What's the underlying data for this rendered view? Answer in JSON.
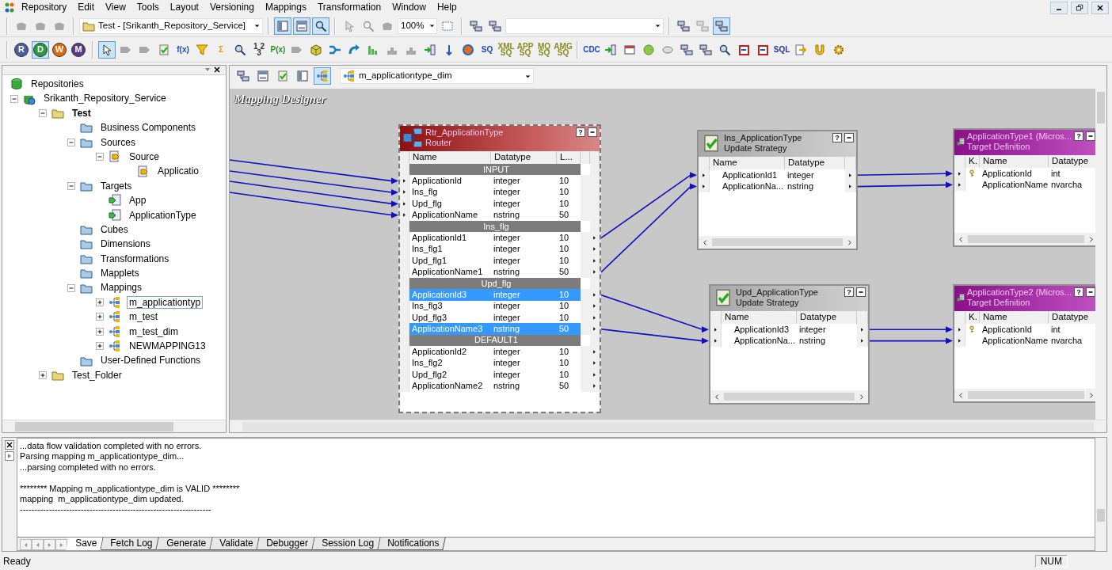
{
  "menu": [
    "Repository",
    "Edit",
    "View",
    "Tools",
    "Layout",
    "Versioning",
    "Mappings",
    "Transformation",
    "Window",
    "Help"
  ],
  "toolbar_1": [
    {
      "kind": "icon",
      "pressed": false
    },
    {
      "kind": "icon",
      "pressed": false
    },
    {
      "kind": "icon",
      "pressed": false
    },
    {
      "kind": "separator"
    },
    {
      "kind": "folder_combo",
      "text": "Test - [Srikanth_Repository_Service]"
    },
    {
      "kind": "separator"
    },
    {
      "kind": "icon",
      "pressed": true
    },
    {
      "kind": "icon",
      "pressed": true
    },
    {
      "kind": "icon",
      "pressed": true
    },
    {
      "kind": "separator"
    },
    {
      "kind": "icon",
      "pressed": false
    },
    {
      "kind": "icon",
      "pressed": false
    },
    {
      "kind": "icon",
      "pressed": false
    },
    {
      "kind": "combo",
      "text": "100%"
    },
    {
      "kind": "icon",
      "pressed": false
    },
    {
      "kind": "separator"
    },
    {
      "kind": "icon",
      "pressed": false
    },
    {
      "kind": "icon",
      "pressed": false
    },
    {
      "kind": "combo"
    },
    {
      "kind": "separator"
    },
    {
      "kind": "icon",
      "pressed": false
    },
    {
      "kind": "icon",
      "pressed": false
    },
    {
      "kind": "icon",
      "pressed": true
    }
  ],
  "toolbar_2": [
    {
      "kind": "circle",
      "text": "R",
      "color": "#4a5ea0",
      "pressed": false
    },
    {
      "kind": "circle",
      "text": "D",
      "color": "#2a9a3a",
      "pressed": true
    },
    {
      "kind": "circle",
      "text": "W",
      "color": "#e06a10",
      "pressed": false
    },
    {
      "kind": "circle",
      "text": "M",
      "color": "#5a3a8a",
      "pressed": false
    },
    {
      "kind": "separator"
    },
    {
      "kind": "icon",
      "pressed": true
    },
    {
      "kind": "icon",
      "pressed": false
    },
    {
      "kind": "icon",
      "pressed": false
    },
    {
      "kind": "icon",
      "pressed": false
    },
    {
      "kind": "label",
      "text": "f(x)",
      "color": "#1a4ac0",
      "pressed": false
    },
    {
      "kind": "icon",
      "pressed": false
    },
    {
      "kind": "label",
      "text": "Σ",
      "color": "#e0a000",
      "pressed": false
    },
    {
      "kind": "icon",
      "pressed": false
    },
    {
      "kind": "label",
      "text": "1 2 3",
      "color": "#333333",
      "pressed": false
    },
    {
      "kind": "label",
      "text": "P(x)",
      "color": "#2a8a2a",
      "pressed": false
    },
    {
      "kind": "icon",
      "pressed": false
    },
    {
      "kind": "icon",
      "pressed": false
    },
    {
      "kind": "icon",
      "pressed": false
    },
    {
      "kind": "icon",
      "pressed": false
    },
    {
      "kind": "icon",
      "pressed": false
    },
    {
      "kind": "icon",
      "pressed": false
    },
    {
      "kind": "icon",
      "pressed": false
    },
    {
      "kind": "icon",
      "pressed": false
    },
    {
      "kind": "icon",
      "pressed": false
    },
    {
      "kind": "icon",
      "pressed": false
    },
    {
      "kind": "label",
      "text": "SQ",
      "color": "#1a4ac0",
      "pressed": false
    },
    {
      "kind": "label",
      "text": "XML SQ",
      "color": "#8a8a20",
      "pressed": false
    },
    {
      "kind": "label",
      "text": "APP SQ",
      "color": "#8a8a20",
      "pressed": false
    },
    {
      "kind": "label",
      "text": "MQ SQ",
      "color": "#8a8a20",
      "pressed": false
    },
    {
      "kind": "label",
      "text": "AMG SQ",
      "color": "#8a8a20",
      "pressed": false
    },
    {
      "kind": "separator"
    },
    {
      "kind": "label",
      "text": "CDC",
      "color": "#1a4ac0",
      "pressed": false
    },
    {
      "kind": "icon",
      "pressed": false
    },
    {
      "kind": "icon",
      "pressed": false
    },
    {
      "kind": "icon",
      "pressed": false
    },
    {
      "kind": "icon",
      "pressed": false
    },
    {
      "kind": "icon",
      "pressed": false
    },
    {
      "kind": "icon",
      "pressed": false
    },
    {
      "kind": "icon",
      "pressed": false
    },
    {
      "kind": "icon",
      "pressed": false
    },
    {
      "kind": "icon",
      "pressed": false
    },
    {
      "kind": "label",
      "text": "SQL",
      "color": "#1a3a9a",
      "pressed": false
    },
    {
      "kind": "icon",
      "pressed": false
    },
    {
      "kind": "icon",
      "pressed": false
    },
    {
      "kind": "icon",
      "pressed": false
    }
  ],
  "navigator": {
    "tree": [
      {
        "label": "Repositories",
        "kind": "repositories",
        "children": [
          {
            "label": "Srikanth_Repository_Service",
            "kind": "repository",
            "expanded": true,
            "children": [
              {
                "label": "Test",
                "kind": "folder",
                "expanded": true,
                "current": true,
                "children": [
                  {
                    "label": "Business Components",
                    "kind": "node_folder"
                  },
                  {
                    "label": "Sources",
                    "kind": "node_folder",
                    "expanded": true,
                    "children": [
                      {
                        "label": "Source",
                        "kind": "source",
                        "expanded": true,
                        "children": [
                          {
                            "label": "Applicatio",
                            "kind": "source"
                          }
                        ]
                      }
                    ]
                  },
                  {
                    "label": "Targets",
                    "kind": "node_folder",
                    "expanded": true,
                    "children": [
                      {
                        "label": "App",
                        "kind": "target"
                      },
                      {
                        "label": "ApplicationType",
                        "kind": "target"
                      }
                    ]
                  },
                  {
                    "label": "Cubes",
                    "kind": "node_folder"
                  },
                  {
                    "label": "Dimensions",
                    "kind": "node_folder"
                  },
                  {
                    "label": "Transformations",
                    "kind": "node_folder"
                  },
                  {
                    "label": "Mapplets",
                    "kind": "node_folder"
                  },
                  {
                    "label": "Mappings",
                    "kind": "node_folder",
                    "expanded": true,
                    "children": [
                      {
                        "label": "m_applicationtyp",
                        "kind": "mapping",
                        "expanded": false,
                        "selected": true
                      },
                      {
                        "label": "m_test",
                        "kind": "mapping",
                        "expanded": false,
                        "selected": false
                      },
                      {
                        "label": "m_test_dim",
                        "kind": "mapping",
                        "expanded": false,
                        "selected": false
                      },
                      {
                        "label": "NEWMAPPING13",
                        "kind": "mapping",
                        "expanded": false,
                        "selected": false
                      }
                    ]
                  },
                  {
                    "label": "User-Defined Functions",
                    "kind": "node_folder"
                  }
                ]
              },
              {
                "label": "Test_Folder",
                "kind": "folder",
                "expanded": false,
                "current": false
              }
            ]
          }
        ]
      }
    ]
  },
  "workspace": {
    "mapping_combo": "m_applicationtype_dim",
    "canvas_title": "Mapping Designer",
    "transformations": [
      {
        "kind": "router",
        "title": "Rtr_ApplicationType",
        "subtitle": "Router",
        "help": "?",
        "selected": true,
        "columns": [
          "Name",
          "Datatype",
          "L..."
        ],
        "groups": [
          {
            "name": "INPUT",
            "kind": "input",
            "ports": [
              {
                "name": "ApplicationId",
                "datatype": "integer",
                "length": "10",
                "selected": false
              },
              {
                "name": "Ins_flg",
                "datatype": "integer",
                "length": "10",
                "selected": false
              },
              {
                "name": "Upd_flg",
                "datatype": "integer",
                "length": "10",
                "selected": false
              },
              {
                "name": "ApplicationName",
                "datatype": "nstring",
                "length": "50",
                "selected": false
              }
            ]
          },
          {
            "name": "Ins_flg",
            "kind": "output",
            "ports": [
              {
                "name": "ApplicationId1",
                "datatype": "integer",
                "length": "10",
                "selected": false
              },
              {
                "name": "Ins_flg1",
                "datatype": "integer",
                "length": "10",
                "selected": false
              },
              {
                "name": "Upd_flg1",
                "datatype": "integer",
                "length": "10",
                "selected": false
              },
              {
                "name": "ApplicationName1",
                "datatype": "nstring",
                "length": "50",
                "selected": false
              }
            ]
          },
          {
            "name": "Upd_flg",
            "kind": "output",
            "ports": [
              {
                "name": "ApplicationId3",
                "datatype": "integer",
                "length": "10",
                "selected": true
              },
              {
                "name": "Ins_flg3",
                "datatype": "integer",
                "length": "10",
                "selected": false
              },
              {
                "name": "Upd_flg3",
                "datatype": "integer",
                "length": "10",
                "selected": false
              },
              {
                "name": "ApplicationName3",
                "datatype": "nstring",
                "length": "50",
                "selected": true
              }
            ]
          },
          {
            "name": "DEFAULT1",
            "kind": "output",
            "ports": [
              {
                "name": "ApplicationId2",
                "datatype": "integer",
                "length": "10",
                "selected": false
              },
              {
                "name": "Ins_flg2",
                "datatype": "integer",
                "length": "10",
                "selected": false
              },
              {
                "name": "Upd_flg2",
                "datatype": "integer",
                "length": "10",
                "selected": false
              },
              {
                "name": "ApplicationName2",
                "datatype": "nstring",
                "length": "50",
                "selected": false
              }
            ]
          }
        ]
      },
      {
        "kind": "update_strategy",
        "title": "Ins_ApplicationType",
        "subtitle": "Update Strategy",
        "help": "?",
        "selected": false,
        "columns": [
          "Name",
          "Datatype"
        ],
        "ports": [
          {
            "name": "ApplicationId1",
            "datatype": "integer"
          },
          {
            "name": "ApplicationNa...",
            "datatype": "nstring"
          }
        ]
      },
      {
        "kind": "target",
        "title": "ApplicationType1 (Micros...",
        "subtitle": "Target Definition",
        "help": "?",
        "selected": false,
        "columns": [
          "K.",
          "Name",
          "Datatype"
        ],
        "ports": [
          {
            "name": "ApplicationId",
            "datatype": "int",
            "key": true
          },
          {
            "name": "ApplicationName",
            "datatype": "nvarcha",
            "key": false
          }
        ]
      },
      {
        "kind": "update_strategy",
        "title": "Upd_ApplicationType",
        "subtitle": "Update Strategy",
        "help": "?",
        "selected": false,
        "columns": [
          "Name",
          "Datatype"
        ],
        "ports": [
          {
            "name": "ApplicationId3",
            "datatype": "integer"
          },
          {
            "name": "ApplicationNa...",
            "datatype": "nstring"
          }
        ]
      },
      {
        "kind": "target",
        "title": "ApplicationType2 (Micros...",
        "subtitle": "Target Definition",
        "help": "?",
        "selected": false,
        "columns": [
          "K.",
          "Name",
          "Datatype"
        ],
        "ports": [
          {
            "name": "ApplicationId",
            "datatype": "int",
            "key": true
          },
          {
            "name": "ApplicationName",
            "datatype": "nvarcha",
            "key": false
          }
        ]
      }
    ]
  },
  "output": {
    "blocks": [
      [
        "...data flow validation completed with no errors.",
        "Parsing mapping m_applicationtype_dim...",
        "...parsing completed with no errors."
      ],
      [
        "******** Mapping m_applicationtype_dim is VALID ********",
        "mapping  m_applicationtype_dim updated.",
        "------------------------------------------------------------------"
      ]
    ],
    "tabs": [
      {
        "label": "Save",
        "selected": true
      },
      {
        "label": "Fetch Log",
        "selected": false
      },
      {
        "label": "Generate",
        "selected": false
      },
      {
        "label": "Validate",
        "selected": false
      },
      {
        "label": "Debugger",
        "selected": false
      },
      {
        "label": "Session Log",
        "selected": false
      },
      {
        "label": "Notifications",
        "selected": false
      }
    ]
  },
  "status_bar": {
    "message": "Ready",
    "indicator": "NUM"
  }
}
